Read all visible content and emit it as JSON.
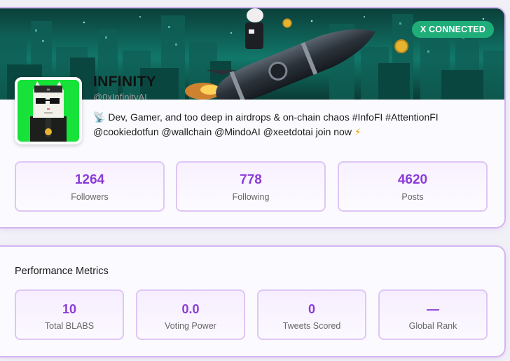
{
  "profile": {
    "badge": "X CONNECTED",
    "name": "INFINITY",
    "handle": "@0xInfinityAI",
    "bio_emoji": "📡",
    "bio_text": "Dev, Gamer, and too deep in airdrops & on-chain chaos #InfoFI #AttentionFI @cookiedotfun @wallchain @MindoAI @xeetdotai join now",
    "bio_end_emoji": "⚡",
    "stats": [
      {
        "value": "1264",
        "label": "Followers"
      },
      {
        "value": "778",
        "label": "Following"
      },
      {
        "value": "4620",
        "label": "Posts"
      }
    ]
  },
  "metrics": {
    "title": "Performance Metrics",
    "items": [
      {
        "value": "10",
        "label": "Total BLABS"
      },
      {
        "value": "0.0",
        "label": "Voting Power"
      },
      {
        "value": "0",
        "label": "Tweets Scored"
      },
      {
        "value": "—",
        "label": "Global Rank"
      }
    ]
  },
  "colors": {
    "accent": "#8b3bd8",
    "card_border": "#d3b5f2",
    "badge_bg": "#1fae7a",
    "avatar_bg": "#16e23a"
  }
}
